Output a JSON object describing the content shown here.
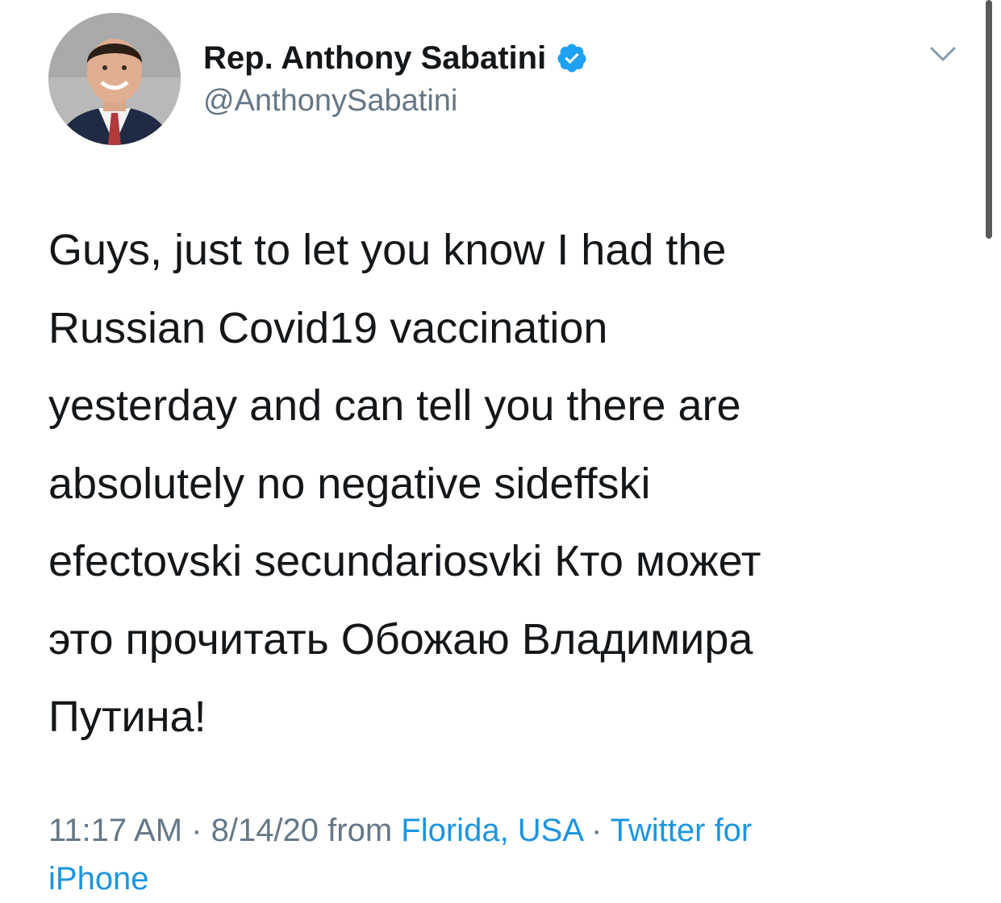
{
  "user": {
    "display_name": "Rep. Anthony Sabatini",
    "handle": "@AnthonySabatini",
    "verified": true
  },
  "icons": {
    "verified": "verified-badge-icon",
    "menu": "chevron-down-icon"
  },
  "tweet": {
    "lines": [
      "Guys, just to let you know I had the",
      "Russian Covid19 vaccination",
      "yesterday and can tell you there are",
      "absolutely no negative sideffski",
      "efectovski secundariosvki Кто может",
      "это прочитать Обожаю Владимира",
      "Путина!"
    ]
  },
  "meta": {
    "time": "11:17 AM",
    "separator_1": " · ",
    "date": "8/14/20",
    "from_text": " from ",
    "location": "Florida, USA",
    "separator_2": " · ",
    "source_part1": "Twitter for",
    "source_part2": "iPhone"
  },
  "colors": {
    "text": "#14171a",
    "secondary": "#657786",
    "link": "#1b95e0",
    "verified": "#1da1f2"
  }
}
